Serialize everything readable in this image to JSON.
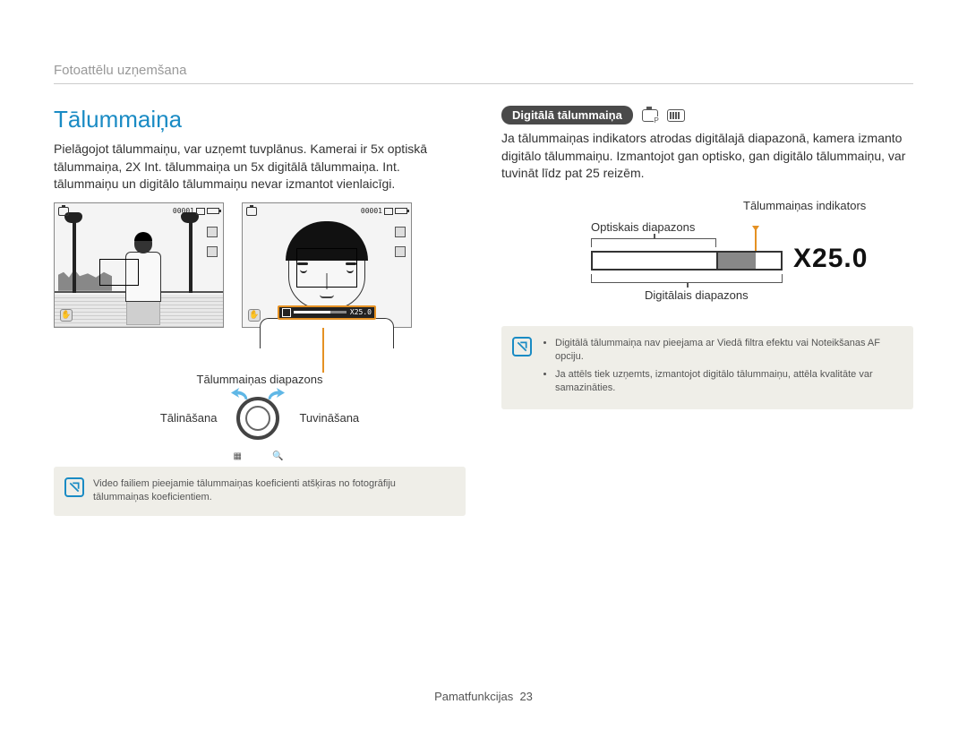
{
  "breadcrumb": "Fotoattēlu uzņemšana",
  "left": {
    "title": "Tālummaiņa",
    "intro": "Pielāgojot tālummaiņu, var uzņemt tuvplānus. Kamerai ir 5x optiskā tālummaiņa, 2X Int. tālummaiņa un 5x digitālā tālummaiņa. Int. tālummaiņu un digitālo tālummaiņu nevar izmantot vienlaicīgi.",
    "shot_counter": "00001",
    "zoombar_text": "X25.0",
    "range_label": "Tālummaiņas diapazons",
    "zoom_out": "Tālināšana",
    "zoom_in": "Tuvināšana",
    "dial_minus": "▦",
    "dial_plus": "🔍",
    "note": "Video failiem pieejamie tālummaiņas koeficienti atšķiras no fotogrāfiju tālummaiņas koeficientiem."
  },
  "right": {
    "chip": "Digitālā tālummaiņa",
    "intro": "Ja tālummaiņas indikators atrodas digitālajā diapazonā, kamera izmanto digitālo tālummaiņu. Izmantojot gan optisko, gan digitālo tālummaiņu, var tuvināt līdz pat 25 reizēm.",
    "indicator_label": "Tālummaiņas indikators",
    "optical_label": "Optiskais diapazons",
    "digital_label": "Digitālais diapazons",
    "x_value": "X25.0",
    "note_items": [
      "Digitālā tālummaiņa nav pieejama ar Viedā filtra efektu vai Noteikšanas AF opciju.",
      "Ja attēls tiek uzņemts, izmantojot digitālo tālummaiņu, attēla kvalitāte var samazināties."
    ]
  },
  "footer": {
    "section": "Pamatfunkcijas",
    "page": "23"
  }
}
